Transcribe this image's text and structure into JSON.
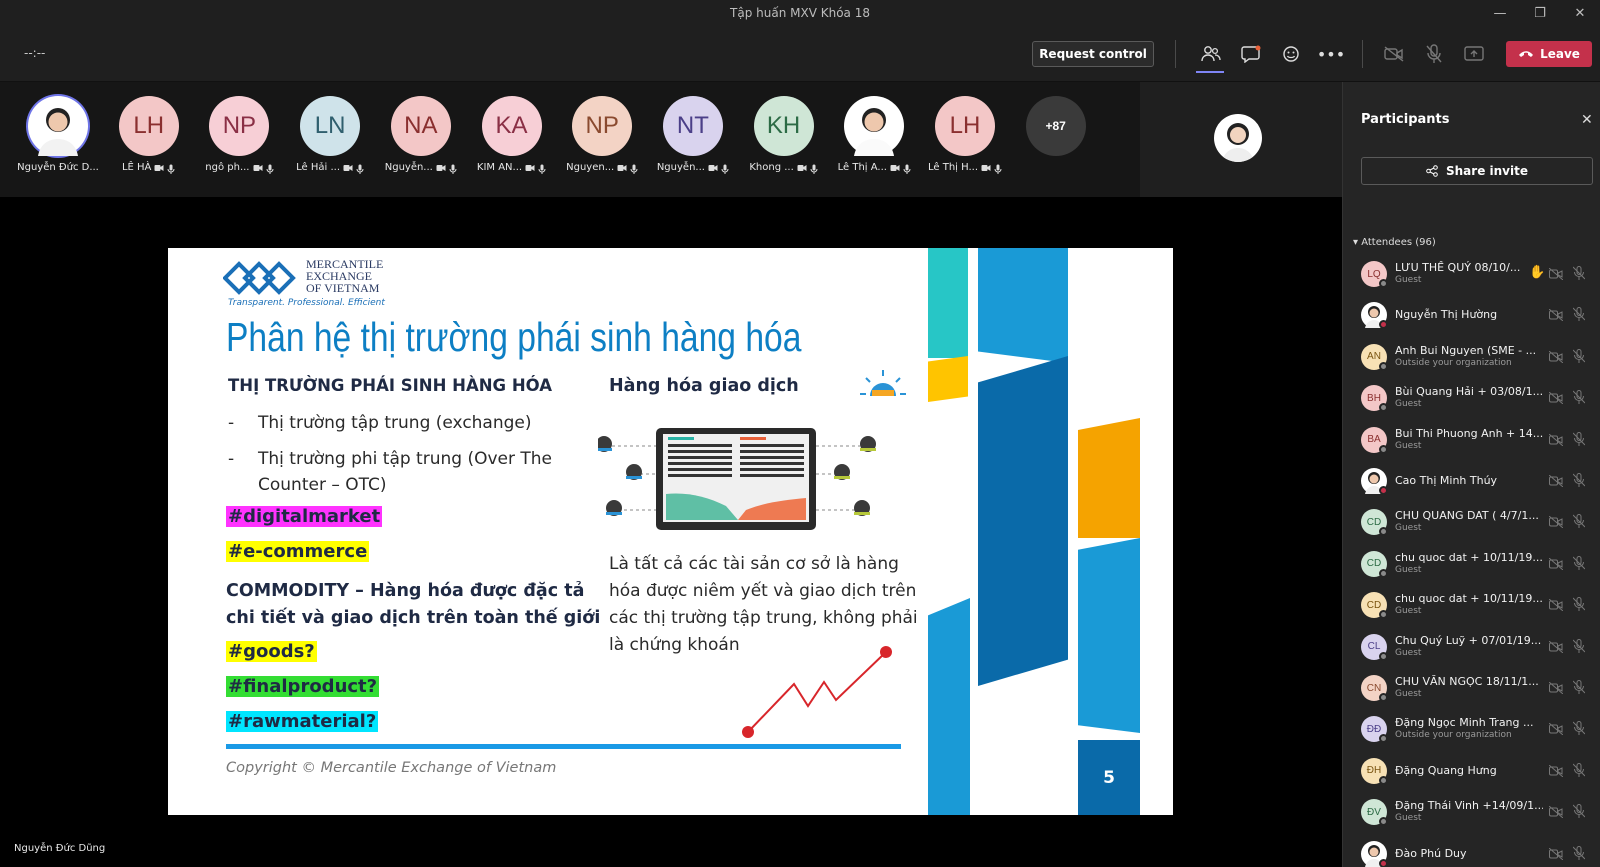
{
  "window": {
    "title": "Tập huấn MXV Khóa 18"
  },
  "toolbar": {
    "timer": "--:--",
    "request_control": "Request control",
    "leave": "Leave"
  },
  "gallery": [
    {
      "initials": "",
      "name": "Nguyễn Đức D...",
      "photo": true
    },
    {
      "initials": "LH",
      "name": "LÊ HÀ"
    },
    {
      "initials": "NP",
      "name": "ngô ph..."
    },
    {
      "initials": "LN",
      "name": "Lê Hải ..."
    },
    {
      "initials": "NA",
      "name": "Nguyễn..."
    },
    {
      "initials": "KA",
      "name": "KIM AN..."
    },
    {
      "initials": "NP",
      "name": "Nguyen..."
    },
    {
      "initials": "NT",
      "name": "Nguyễn..."
    },
    {
      "initials": "KH",
      "name": "Khong ..."
    },
    {
      "initials": "",
      "name": "Lê Thị A...",
      "photo": true
    },
    {
      "initials": "LH",
      "name": "Lê Thị H..."
    },
    {
      "initials": "+87",
      "name": ""
    }
  ],
  "presenter": {
    "name": "Nguyễn Đức Dũng"
  },
  "slide": {
    "logo_line1": "MERCANTILE",
    "logo_line2": "EXCHANGE",
    "logo_line3": "OF VIETNAM",
    "tagline": "Transparent. Professional. Efficient",
    "title": "Phân hệ thị trường phái sinh hàng hóa",
    "left_heading": "THỊ TRƯỜNG PHÁI SINH HÀNG HÓA",
    "bullet1": "Thị trường tập trung (exchange)",
    "bullet2a": "Thị trường phi tập trung (Over The",
    "bullet2b": "Counter – OTC)",
    "tag_digital": "#digitalmarket",
    "tag_ecommerce": "#e-commerce",
    "commodity_line1": "COMMODITY – Hàng hóa được đặc tả",
    "commodity_line2": "chi tiết và giao dịch trên toàn thế giới",
    "tag_goods": "#goods?",
    "tag_final": "#finalproduct?",
    "tag_raw": "#rawmaterial?",
    "right_heading": "Hàng hóa giao dịch",
    "desc1": "Là tất cả các tài sản cơ sở là hàng",
    "desc2": "hóa được niêm yết và giao dịch trên",
    "desc3": "các thị trường tập trung, không phải",
    "desc4": "là chứng khoán",
    "copyright": "Copyright © Mercantile Exchange of Vietnam",
    "page": "5"
  },
  "panel": {
    "title": "Participants",
    "share": "Share invite",
    "attendees": "Attendees (96)",
    "people": [
      {
        "init": "LQ",
        "name": "LƯU THẾ QUÝ 08/10/...",
        "sub": "Guest",
        "bg": "#f3c7c7",
        "fg": "#8a2f2f",
        "hand": true
      },
      {
        "init": "",
        "name": "Nguyễn Thị Hường",
        "sub": "",
        "bg": "#ffffff",
        "fg": "#333",
        "photo": true
      },
      {
        "init": "AN",
        "name": "Anh Bui Nguyen (SME - ...",
        "sub": "Outside your organization",
        "bg": "#f7e1b5",
        "fg": "#7a5410"
      },
      {
        "init": "BH",
        "name": "Bùi Quang Hải + 03/08/1...",
        "sub": "Guest",
        "bg": "#f3c7c7",
        "fg": "#8a2f2f"
      },
      {
        "init": "BA",
        "name": "Bui Thi Phuong Anh + 14...",
        "sub": "Guest",
        "bg": "#f3c7c7",
        "fg": "#8a2f2f"
      },
      {
        "init": "",
        "name": "Cao Thị Minh Thúy",
        "sub": "",
        "bg": "#ffffff",
        "fg": "#333",
        "photo": true
      },
      {
        "init": "CD",
        "name": "CHU QUANG DAT ( 4/7/1...",
        "sub": "Guest",
        "bg": "#cfe6d6",
        "fg": "#2c6b45"
      },
      {
        "init": "CD",
        "name": "chu quoc dat + 10/11/19...",
        "sub": "Guest",
        "bg": "#cfe6d6",
        "fg": "#2c6b45"
      },
      {
        "init": "CD",
        "name": "chu quoc dat + 10/11/19...",
        "sub": "Guest",
        "bg": "#f7e1b5",
        "fg": "#7a5410"
      },
      {
        "init": "CL",
        "name": "Chu Quý Luỹ + 07/01/19...",
        "sub": "Guest",
        "bg": "#d9d3ee",
        "fg": "#4b3f88"
      },
      {
        "init": "CN",
        "name": "CHU VĂN NGỌC 18/11/1...",
        "sub": "Guest",
        "bg": "#f3d3c5",
        "fg": "#8a4a2f"
      },
      {
        "init": "ĐĐ",
        "name": "Đặng Ngọc Minh Trang ...",
        "sub": "Outside your organization",
        "bg": "#d9d3ee",
        "fg": "#4b3f88"
      },
      {
        "init": "ĐH",
        "name": "Đặng Quang Hưng",
        "sub": "",
        "bg": "#f7e1b5",
        "fg": "#7a5410"
      },
      {
        "init": "ĐV",
        "name": "Đặng Thái Vinh +14/09/1...",
        "sub": "Guest",
        "bg": "#cfe6d6",
        "fg": "#2c6b45"
      },
      {
        "init": "",
        "name": "Đào Phú Duy",
        "sub": "",
        "bg": "#ffffff",
        "fg": "#333",
        "photo": true
      }
    ]
  },
  "colors": {
    "accent": "#5b5fc7",
    "leave": "#c4314b",
    "title_blue": "#0d7fc4",
    "magenta": "#ff33ff",
    "yellow": "#ffff00",
    "green": "#33dd33",
    "cyan": "#00e5ff"
  }
}
